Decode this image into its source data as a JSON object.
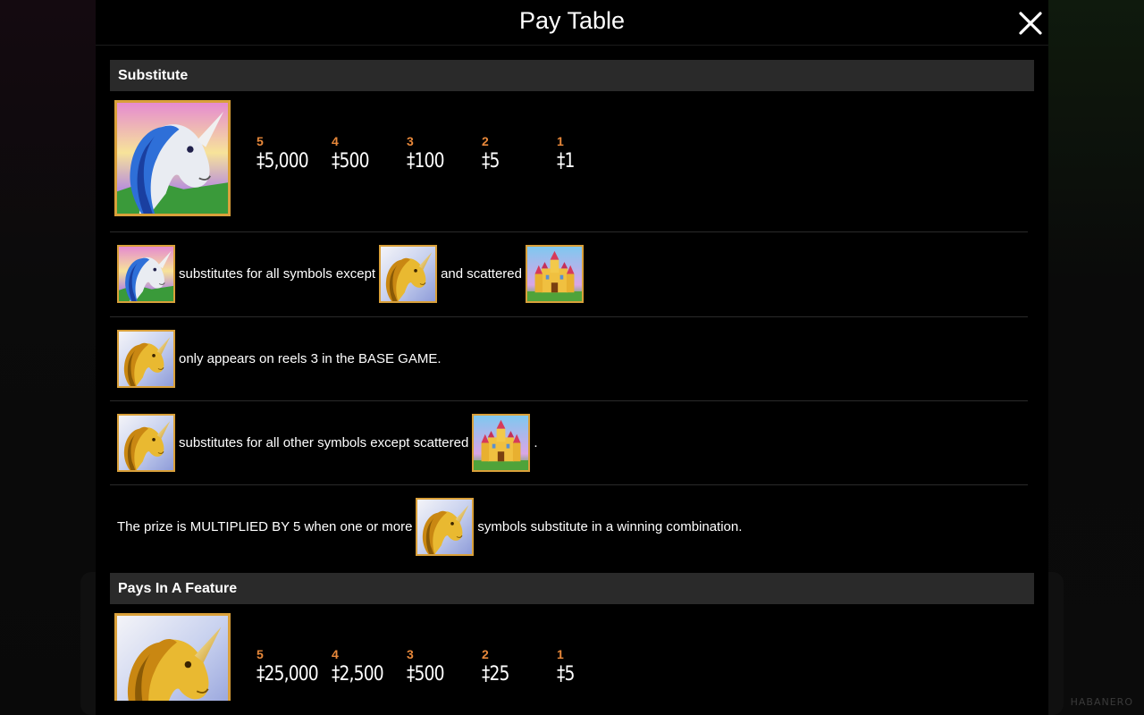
{
  "window": {
    "title": "Pay Table"
  },
  "watermark": "HABANERO",
  "sections": [
    {
      "header": "Substitute",
      "symbol_icon": "blue-unicorn-wild-icon",
      "pays": [
        {
          "count": "5",
          "amount": "‡5,000"
        },
        {
          "count": "4",
          "amount": "‡500"
        },
        {
          "count": "3",
          "amount": "‡100"
        },
        {
          "count": "2",
          "amount": "‡5"
        },
        {
          "count": "1",
          "amount": "‡1"
        }
      ],
      "rules": [
        {
          "text1": "substitutes for all symbols except",
          "text2": "and scattered"
        },
        {
          "text1": "only appears on reels 3 in the BASE GAME."
        },
        {
          "text1": "substitutes for all other symbols except scattered",
          "text2": "."
        },
        {
          "text1": "The prize is MULTIPLIED BY 5 when one or more",
          "text2": "symbols substitute in a winning combination."
        }
      ]
    },
    {
      "header": "Pays In A Feature",
      "symbol_icon": "gold-unicorn-icon",
      "pays": [
        {
          "count": "5",
          "amount": "‡25,000"
        },
        {
          "count": "4",
          "amount": "‡2,500"
        },
        {
          "count": "3",
          "amount": "‡500"
        },
        {
          "count": "2",
          "amount": "‡25"
        },
        {
          "count": "1",
          "amount": "‡5"
        }
      ]
    }
  ],
  "colors": {
    "accent": "#e8883a",
    "frame": "#d9a03a",
    "section_bg": "#2a2a2a",
    "panel_bg": "#000000"
  }
}
